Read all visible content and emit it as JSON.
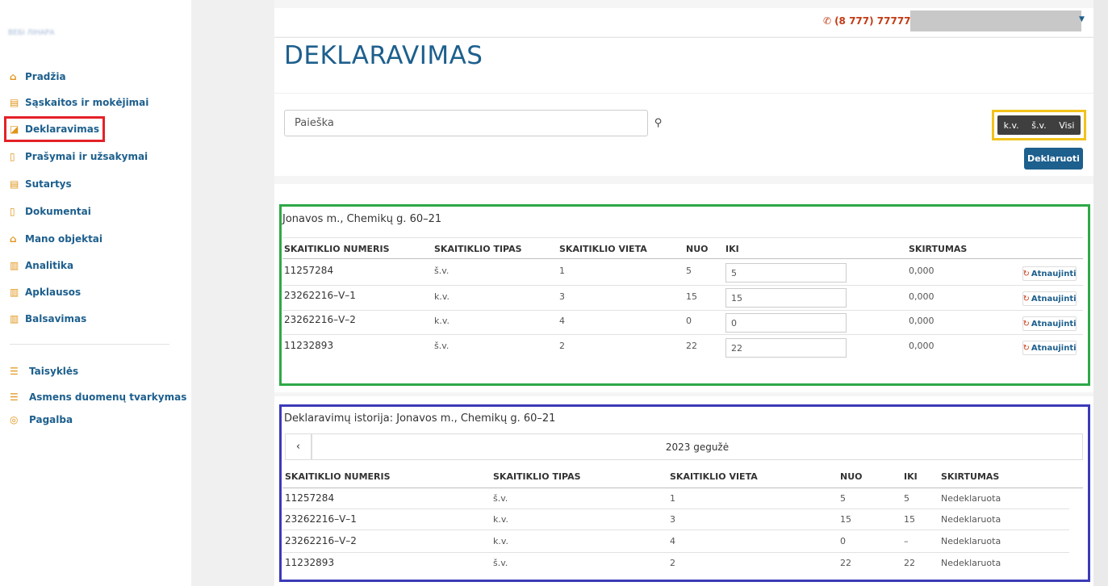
{
  "sidebar": {
    "brand": "ВЕБІ ЛІНАРА",
    "items": [
      {
        "icon": "home-icon",
        "label": "Pradžia"
      },
      {
        "icon": "invoice-icon",
        "label": "Sąskaitos ir mokėjimai"
      },
      {
        "icon": "declare-icon",
        "label": "Deklaravimas"
      },
      {
        "icon": "file-icon",
        "label": "Prašymai ir užsakymai"
      },
      {
        "icon": "contract-icon",
        "label": "Sutartys"
      },
      {
        "icon": "document-icon",
        "label": "Dokumentai"
      },
      {
        "icon": "home-icon",
        "label": "Mano objektai"
      },
      {
        "icon": "chart-icon",
        "label": "Analitika"
      },
      {
        "icon": "survey-icon",
        "label": "Apklausos"
      },
      {
        "icon": "vote-icon",
        "label": "Balsavimas"
      }
    ],
    "secondary": [
      {
        "icon": "list-icon",
        "label": "Taisyklės"
      },
      {
        "icon": "list-icon",
        "label": "Asmens duomenų tvarkymas"
      },
      {
        "icon": "lifebuoy-icon",
        "label": "Pagalba"
      }
    ]
  },
  "topbar": {
    "phone": "(8 777) 77777"
  },
  "header": {
    "title": "DEKLARAVIMAS",
    "search_placeholder": "Paieška",
    "filters": [
      "k.v.",
      "š.v.",
      "Visi"
    ],
    "declare_label": "Deklaruoti"
  },
  "meters": {
    "title": "Jonavos m., Chemikų g. 60–21",
    "columns": [
      "SKAITIKLIO NUMERIS",
      "SKAITIKLIO TIPAS",
      "SKAITIKLIO VIETA",
      "NUO",
      "IKI",
      "SKIRTUMAS"
    ],
    "rows": [
      {
        "number": "11257284",
        "type": "š.v.",
        "place": "1",
        "from": "5",
        "to": "5",
        "diff": "0,000"
      },
      {
        "number": "23262216–V–1",
        "type": "k.v.",
        "place": "3",
        "from": "15",
        "to": "15",
        "diff": "0,000"
      },
      {
        "number": "23262216–V–2",
        "type": "k.v.",
        "place": "4",
        "from": "0",
        "to": "0",
        "diff": "0,000"
      },
      {
        "number": "11232893",
        "type": "š.v.",
        "place": "2",
        "from": "22",
        "to": "22",
        "diff": "0,000"
      }
    ],
    "update_label": "Atnaujinti"
  },
  "history": {
    "title": "Deklaravimų istorija: Jonavos m., Chemikų g. 60–21",
    "month": "2023 gegužė",
    "columns": [
      "SKAITIKLIO NUMERIS",
      "SKAITIKLIO TIPAS",
      "SKAITIKLIO VIETA",
      "NUO",
      "IKI",
      "SKIRTUMAS"
    ],
    "rows": [
      {
        "number": "11257284",
        "type": "š.v.",
        "place": "1",
        "from": "5",
        "to": "5",
        "diff": "Nedeklaruota"
      },
      {
        "number": "23262216–V–1",
        "type": "k.v.",
        "place": "3",
        "from": "15",
        "to": "15",
        "diff": "Nedeklaruota"
      },
      {
        "number": "23262216–V–2",
        "type": "k.v.",
        "place": "4",
        "from": "0",
        "to": "–",
        "diff": "Nedeklaruota"
      },
      {
        "number": "11232893",
        "type": "š.v.",
        "place": "2",
        "from": "22",
        "to": "22",
        "diff": "Nedeklaruota"
      }
    ]
  }
}
